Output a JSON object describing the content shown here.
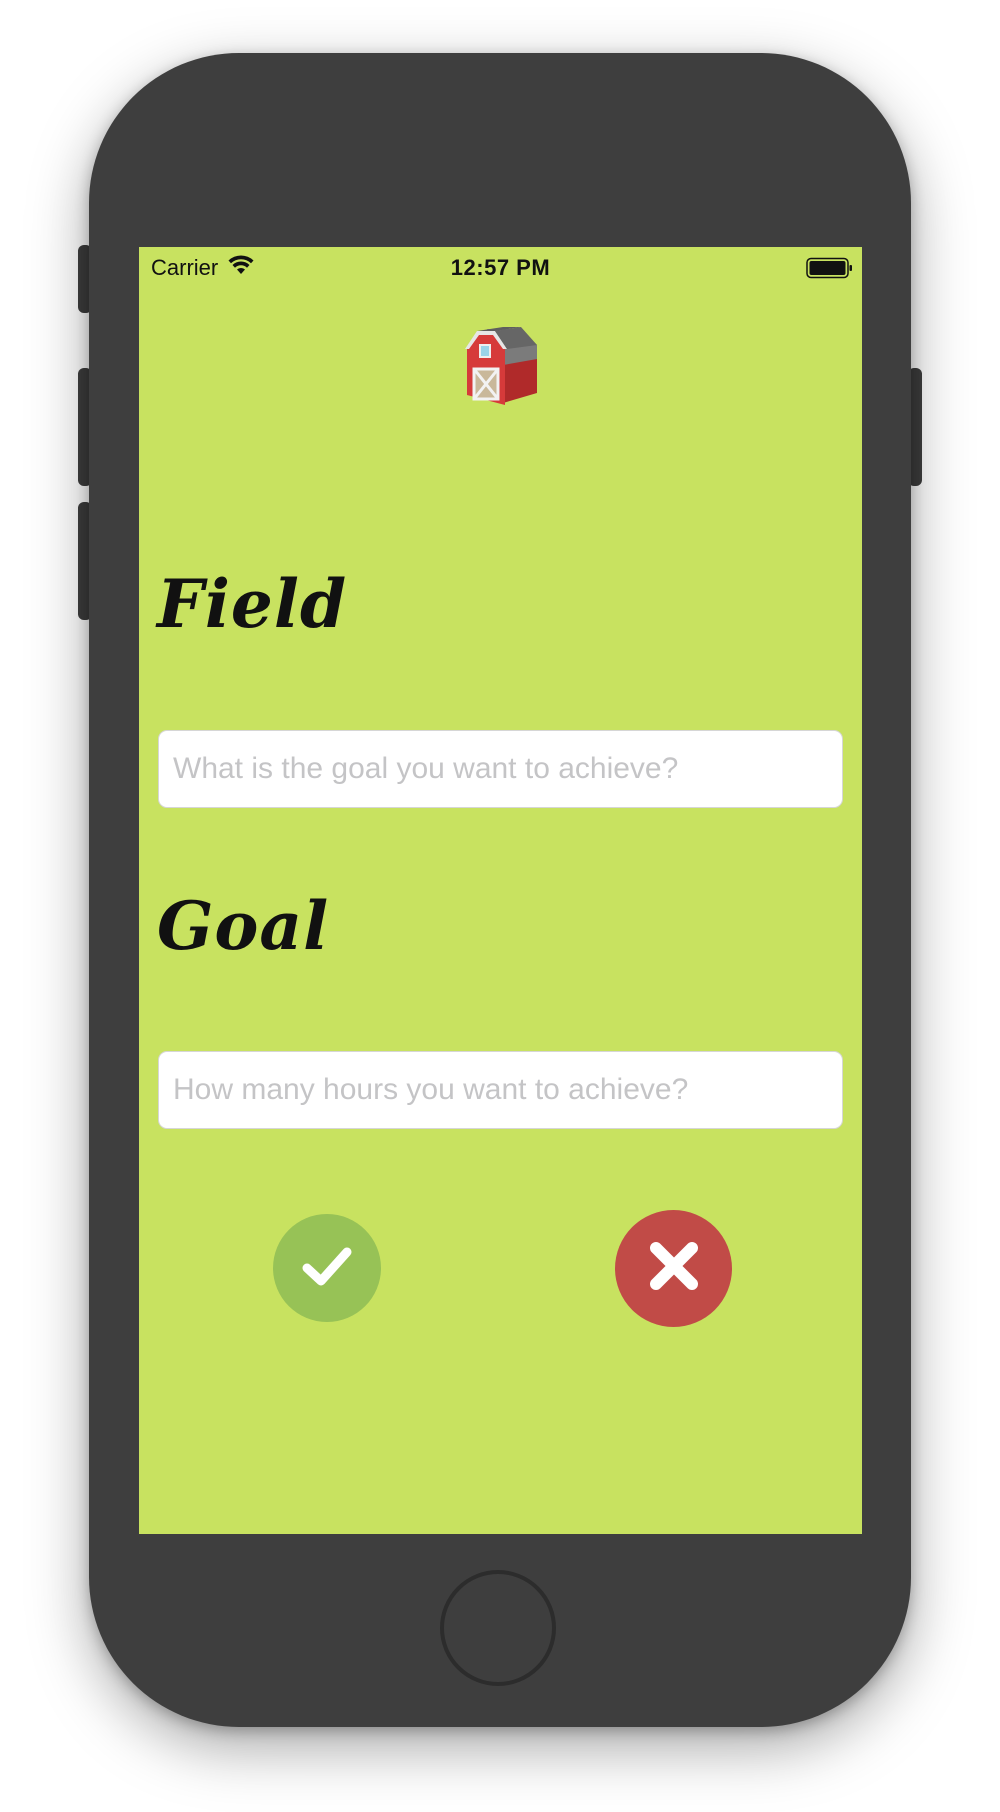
{
  "status_bar": {
    "carrier": "Carrier",
    "time": "12:57 PM",
    "wifi_icon": "wifi-icon",
    "battery_icon": "battery-full-icon"
  },
  "header": {
    "icon": "barn-icon"
  },
  "form": {
    "field_label": "Field",
    "field_placeholder": "What is the goal you want to achieve?",
    "field_value": "",
    "goal_label": "Goal",
    "goal_placeholder": "How many hours you want to achieve?",
    "goal_value": ""
  },
  "actions": {
    "confirm_icon": "checkmark-icon",
    "cancel_icon": "close-icon"
  },
  "colors": {
    "screen_background": "#c8e260",
    "confirm": "#97c256",
    "cancel": "#c14b47",
    "phone_body": "#3e3e3e"
  }
}
